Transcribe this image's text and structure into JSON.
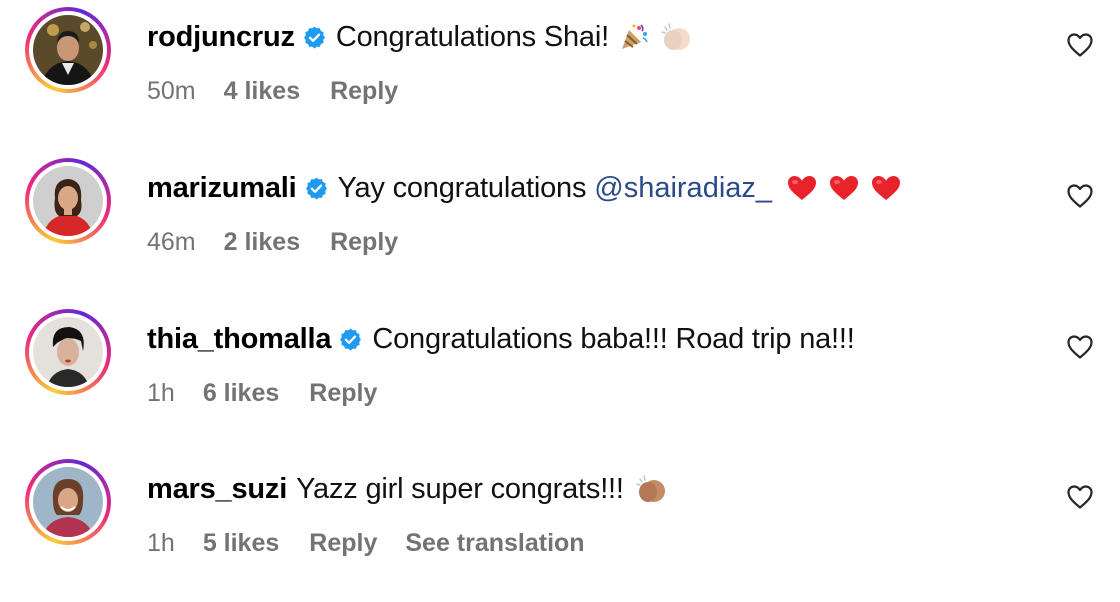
{
  "comments": [
    {
      "username": "rodjuncruz",
      "verified": true,
      "text": "Congratulations Shai!",
      "emojis": [
        "party-popper-icon",
        "clapping-hands-light-icon"
      ],
      "time": "50m",
      "likes": "4 likes",
      "reply": "Reply"
    },
    {
      "username": "marizumali",
      "verified": true,
      "text": "Yay congratulations",
      "mention": "@shairadiaz_",
      "emojis": [
        "red-heart-icon",
        "red-heart-icon",
        "red-heart-icon"
      ],
      "time": "46m",
      "likes": "2 likes",
      "reply": "Reply"
    },
    {
      "username": "thia_thomalla",
      "verified": true,
      "text": "Congratulations baba!!! Road trip na!!!",
      "time": "1h",
      "likes": "6 likes",
      "reply": "Reply"
    },
    {
      "username": "mars_suzi",
      "verified": false,
      "text": "Yazz girl super congrats!!!",
      "emojis": [
        "clapping-hands-medium-icon"
      ],
      "time": "1h",
      "likes": "5 likes",
      "reply": "Reply",
      "translation": "See translation"
    }
  ],
  "colors": {
    "verified_blue": "#1d9bf0",
    "mention": "#2c4a8a",
    "meta_gray": "#737373",
    "heart_red": "#e8232b",
    "story_ring": [
      "#f9ce34",
      "#ee2a7b",
      "#6228d7"
    ]
  }
}
